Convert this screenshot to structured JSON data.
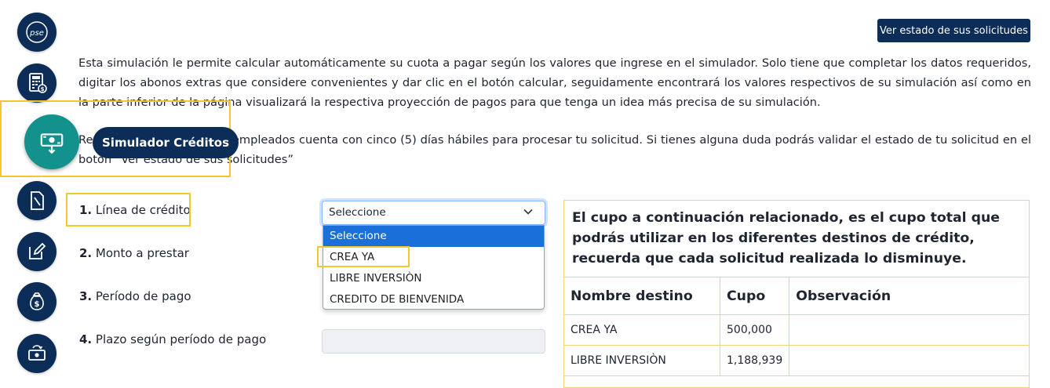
{
  "sidebar": {
    "icons": [
      {
        "name": "pse-icon",
        "label": "pse"
      },
      {
        "name": "calculator-invoice-icon"
      },
      {
        "name": "credit-simulator-icon",
        "active": true
      },
      {
        "name": "document-icon"
      },
      {
        "name": "edit-icon"
      },
      {
        "name": "money-bag-icon"
      },
      {
        "name": "cash-transfer-icon"
      }
    ],
    "tooltip": "Simulador Créditos"
  },
  "header": {
    "status_button": "Ver estado de sus solicitudes"
  },
  "intro": {
    "paragraph1": "Esta simulación le permite calcular automáticamente su cuota a pagar según los valores que ingrese en el simulador. Solo tiene que completar los datos requeridos, digitar los abonos extras que considere convenientes y dar clic en el botón calcular, seguidamente encontrará los valores respectivos de su simulación así como en la parte inferior de la página visualizará la respectiva proyección de pagos para que tenga un idea más precisa de su simulación.",
    "paragraph2": "Recuerda que el Fondo de empleados cuenta con cinco (5) días hábiles para procesar tu solicitud. Si tienes alguna duda podrás validar el estado de tu solicitud en el botón “Ver estado de sus solicitudes”"
  },
  "form": {
    "fields": [
      {
        "num": "1.",
        "label": "Línea de crédito"
      },
      {
        "num": "2.",
        "label": "Monto a prestar"
      },
      {
        "num": "3.",
        "label": "Período de pago"
      },
      {
        "num": "4.",
        "label": "Plazo según período de pago"
      }
    ],
    "credit_line_select": {
      "value": "Seleccione",
      "options": [
        "Seleccione",
        "CREA YA",
        "LIBRE INVERSIÒN",
        "CREDITO DE BIENVENIDA"
      ]
    }
  },
  "cupo": {
    "description": "El cupo a continuación relacionado, es el cupo total que podrás utilizar en los diferentes destinos de crédito, recuerda que cada solicitud realizada lo disminuye.",
    "columns": [
      "Nombre destino",
      "Cupo",
      "Observación"
    ],
    "rows": [
      {
        "destino": "CREA YA",
        "cupo": "500,000",
        "observacion": ""
      },
      {
        "destino": "LIBRE INVERSIÒN",
        "cupo": "1,188,939",
        "observacion": ""
      }
    ]
  },
  "colors": {
    "navy": "#0b2d57",
    "teal": "#13918c",
    "highlight": "#f2c82e",
    "select_blue": "#1a6fd9"
  }
}
